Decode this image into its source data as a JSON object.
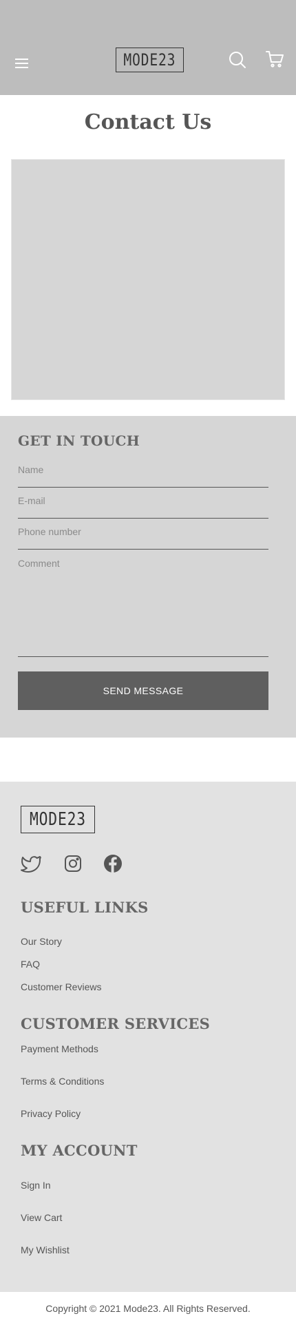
{
  "header": {
    "logo": "MODE23",
    "icons": [
      "menu-icon",
      "search-icon",
      "cart-icon"
    ],
    "background": "#bdbdbd"
  },
  "page": {
    "title": "Contact Us"
  },
  "contact": {
    "heading": "GET IN TOUCH",
    "fields": {
      "name_placeholder": "Name",
      "email_placeholder": "E-mail",
      "phone_placeholder": "Phone number",
      "comment_placeholder": "Comment"
    },
    "send_label": "SEND MESSAGE",
    "button_color": "#5f5f5f"
  },
  "footer": {
    "logo": "MODE23",
    "social_icons": [
      "twitter-icon",
      "instagram-icon",
      "facebook-icon"
    ],
    "useful_links": {
      "heading": "USEFUL LINKS",
      "items": [
        "Our Story",
        "FAQ",
        "Customer Reviews"
      ]
    },
    "customer_services": {
      "heading": "CUSTOMER SERVICES",
      "items": [
        "Payment Methods",
        "Terms & Conditions",
        "Privacy Policy"
      ]
    },
    "my_account": {
      "heading": "MY ACCOUNT",
      "items": [
        "Sign In",
        "View Cart",
        "My Wishlist"
      ]
    },
    "copyright": "Copyright © 2021 Mode23. All Rights Reserved."
  }
}
